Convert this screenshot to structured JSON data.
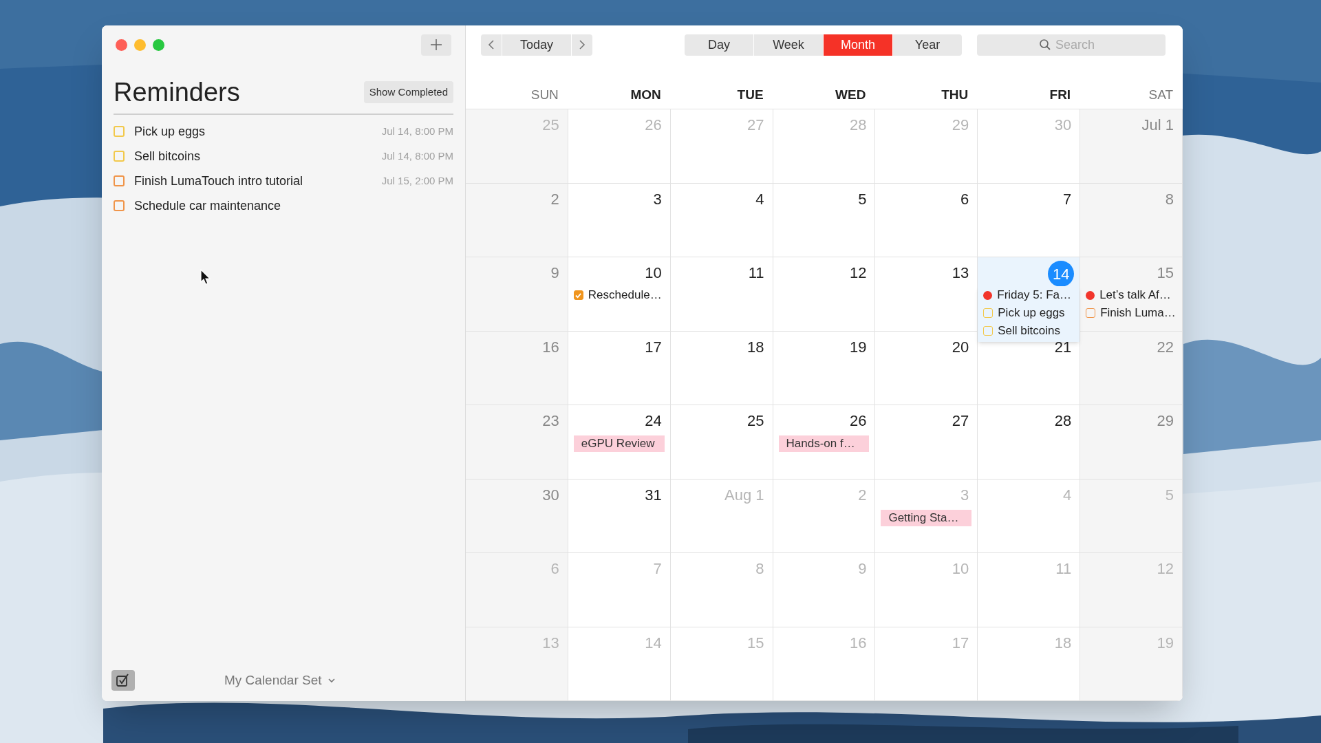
{
  "sidebar": {
    "title": "Reminders",
    "show_completed": "Show Completed",
    "reminders": [
      {
        "title": "Pick up eggs",
        "due": "Jul 14, 8:00 PM",
        "color": "#f2c94c",
        "checked": false
      },
      {
        "title": "Sell bitcoins",
        "due": "Jul 14, 8:00 PM",
        "color": "#f2c94c",
        "checked": false
      },
      {
        "title": "Finish LumaTouch intro tutorial",
        "due": "Jul 15, 2:00 PM",
        "color": "#f0954a",
        "checked": false
      },
      {
        "title": "Schedule car maintenance",
        "color": "#f0954a",
        "checked": false
      }
    ],
    "calendar_set": "My Calendar Set"
  },
  "toolbar": {
    "today": "Today",
    "views": [
      {
        "label": "Day",
        "selected": false
      },
      {
        "label": "Week",
        "selected": false
      },
      {
        "label": "Month",
        "selected": true
      },
      {
        "label": "Year",
        "selected": false
      }
    ],
    "search": {
      "placeholder": "Search"
    }
  },
  "weekdays": [
    "SUN",
    "MON",
    "TUE",
    "WED",
    "THU",
    "FRI",
    "SAT"
  ],
  "weeks": [
    [
      {
        "label": "25",
        "current": false,
        "today": false
      },
      {
        "label": "26",
        "current": false,
        "today": false
      },
      {
        "label": "27",
        "current": false,
        "today": false
      },
      {
        "label": "28",
        "current": false,
        "today": false
      },
      {
        "label": "29",
        "current": false,
        "today": false
      },
      {
        "label": "30",
        "current": false,
        "today": false
      },
      {
        "label": "Jul 1",
        "current": true,
        "today": false
      }
    ],
    [
      {
        "label": "2",
        "current": true,
        "today": false
      },
      {
        "label": "3",
        "current": true,
        "today": false
      },
      {
        "label": "4",
        "current": true,
        "today": false
      },
      {
        "label": "5",
        "current": true,
        "today": false
      },
      {
        "label": "6",
        "current": true,
        "today": false
      },
      {
        "label": "7",
        "current": true,
        "today": false
      },
      {
        "label": "8",
        "current": true,
        "today": false
      }
    ],
    [
      {
        "label": "9",
        "current": true,
        "today": false
      },
      {
        "label": "10",
        "current": true,
        "today": false,
        "events": [
          {
            "kind": "reminder",
            "title": "Reschedule…",
            "color": "#f0951e",
            "checked": true
          }
        ]
      },
      {
        "label": "11",
        "current": true,
        "today": false
      },
      {
        "label": "12",
        "current": true,
        "today": false
      },
      {
        "label": "13",
        "current": true,
        "today": false
      },
      {
        "label": "14",
        "current": true,
        "today": true,
        "events": [
          {
            "kind": "event",
            "title": "Friday 5: Fa…",
            "color": "#f2352b"
          },
          {
            "kind": "reminder",
            "title": "Pick up eggs",
            "color": "#f2c94c",
            "checked": false
          },
          {
            "kind": "reminder",
            "title": "Sell bitcoins",
            "color": "#f2c94c",
            "checked": false
          }
        ]
      },
      {
        "label": "15",
        "current": true,
        "today": false,
        "events": [
          {
            "kind": "event",
            "title": "Let’s talk Af…",
            "color": "#f2352b"
          },
          {
            "kind": "reminder",
            "title": "Finish Luma…",
            "color": "#f0954a",
            "checked": false
          }
        ]
      }
    ],
    [
      {
        "label": "16",
        "current": true,
        "today": false
      },
      {
        "label": "17",
        "current": true,
        "today": false
      },
      {
        "label": "18",
        "current": true,
        "today": false
      },
      {
        "label": "19",
        "current": true,
        "today": false
      },
      {
        "label": "20",
        "current": true,
        "today": false
      },
      {
        "label": "21",
        "current": true,
        "today": false
      },
      {
        "label": "22",
        "current": true,
        "today": false
      }
    ],
    [
      {
        "label": "23",
        "current": true,
        "today": false
      },
      {
        "label": "24",
        "current": true,
        "today": false,
        "events": [
          {
            "kind": "block",
            "title": "eGPU Review",
            "color": "#fcd0da"
          }
        ]
      },
      {
        "label": "25",
        "current": true,
        "today": false
      },
      {
        "label": "26",
        "current": true,
        "today": false,
        "events": [
          {
            "kind": "block",
            "title": "Hands-on f…",
            "color": "#fcd0da"
          }
        ]
      },
      {
        "label": "27",
        "current": true,
        "today": false
      },
      {
        "label": "28",
        "current": true,
        "today": false
      },
      {
        "label": "29",
        "current": true,
        "today": false
      }
    ],
    [
      {
        "label": "30",
        "current": true,
        "today": false
      },
      {
        "label": "31",
        "current": true,
        "today": false
      },
      {
        "label": "Aug 1",
        "current": false,
        "today": false
      },
      {
        "label": "2",
        "current": false,
        "today": false
      },
      {
        "label": "3",
        "current": false,
        "today": false,
        "events": [
          {
            "kind": "block",
            "title": "Getting Sta…",
            "color": "#fcd0da"
          }
        ]
      },
      {
        "label": "4",
        "current": false,
        "today": false
      },
      {
        "label": "5",
        "current": false,
        "today": false
      }
    ],
    [
      {
        "label": "6",
        "current": false,
        "today": false
      },
      {
        "label": "7",
        "current": false,
        "today": false
      },
      {
        "label": "8",
        "current": false,
        "today": false
      },
      {
        "label": "9",
        "current": false,
        "today": false
      },
      {
        "label": "10",
        "current": false,
        "today": false
      },
      {
        "label": "11",
        "current": false,
        "today": false
      },
      {
        "label": "12",
        "current": false,
        "today": false
      }
    ],
    [
      {
        "label": "13",
        "current": false,
        "today": false
      },
      {
        "label": "14",
        "current": false,
        "today": false
      },
      {
        "label": "15",
        "current": false,
        "today": false
      },
      {
        "label": "16",
        "current": false,
        "today": false
      },
      {
        "label": "17",
        "current": false,
        "today": false
      },
      {
        "label": "18",
        "current": false,
        "today": false
      },
      {
        "label": "19",
        "current": false,
        "today": false
      }
    ]
  ]
}
